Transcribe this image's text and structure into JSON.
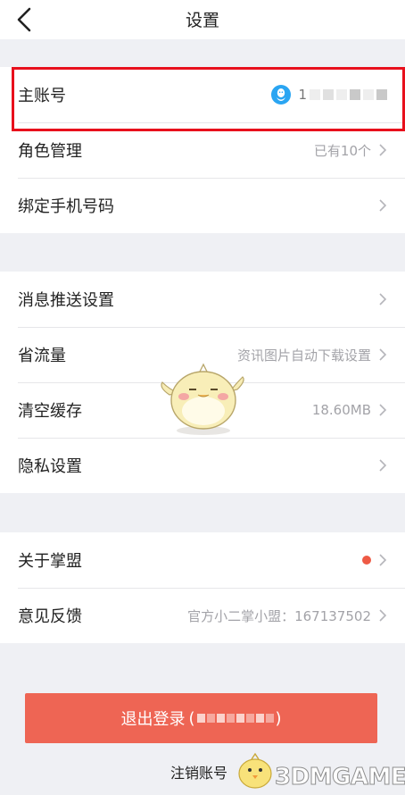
{
  "header": {
    "title": "设置",
    "back_icon": "back-arrow-icon"
  },
  "account": {
    "label": "主账号",
    "icon": "qq-icon",
    "icon_color": "#2aa5f2",
    "value_visible_prefix": "1"
  },
  "roles": {
    "label": "角色管理",
    "value": "已有10个"
  },
  "phone": {
    "label": "绑定手机号码"
  },
  "push": {
    "label": "消息推送设置"
  },
  "data_saver": {
    "label": "省流量",
    "value": "资讯图片自动下载设置"
  },
  "cache": {
    "label": "清空缓存",
    "value": "18.60MB"
  },
  "privacy": {
    "label": "隐私设置"
  },
  "about": {
    "label": "关于掌盟",
    "badge_color": "#ee5a45"
  },
  "feedback": {
    "label": "意见反馈",
    "value": "官方小二掌小盟：167137502"
  },
  "logout": {
    "label": "退出登录",
    "open_paren": "(",
    "close_paren": ")",
    "color": "#ee6554"
  },
  "cancel_account": {
    "label": "注销账号"
  },
  "watermark": {
    "text": "3DMGAME"
  },
  "highlight_color": "#e8101c"
}
